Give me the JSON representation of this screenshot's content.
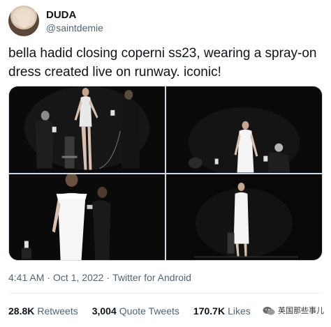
{
  "user": {
    "display_name": "DUDA",
    "handle": "@saintdemie"
  },
  "tweet": {
    "text": "bella hadid closing coperni ss23, wearing a spray-on dress created live on runway. iconic!",
    "time": "4:41 AM",
    "date": "Oct 1, 2022",
    "source": "Twitter for Android",
    "separator": "·"
  },
  "media": [
    {
      "label": "photo-1"
    },
    {
      "label": "photo-2"
    },
    {
      "label": "photo-3"
    },
    {
      "label": "photo-4"
    }
  ],
  "stats": {
    "retweets_count": "28.8K",
    "retweets_label": "Retweets",
    "quotes_count": "3,004",
    "quotes_label": "Quote Tweets",
    "likes_count": "170.7K",
    "likes_label": "Likes"
  },
  "watermark": {
    "text": "英国那些事儿",
    "icon": "wechat-icon"
  },
  "colors": {
    "text_primary": "#0f1419",
    "text_secondary": "#536471",
    "border": "#cfd9de"
  }
}
